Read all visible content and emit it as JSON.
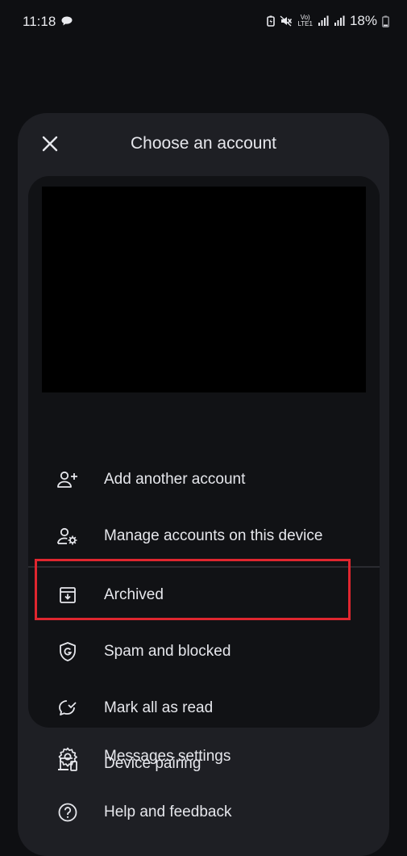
{
  "status_bar": {
    "time": "11:18",
    "volte_line1": "Vo)",
    "volte_line2": "LTE1",
    "battery": "18%"
  },
  "sheet": {
    "title": "Choose an account",
    "close_icon": "close-icon"
  },
  "menu": {
    "add_account": "Add another account",
    "manage_accounts": "Manage accounts on this device",
    "archived": "Archived",
    "spam": "Spam and blocked",
    "mark_read": "Mark all as read",
    "device_pairing": "Device pairing"
  },
  "outer_menu": {
    "settings": "Messages settings",
    "help": "Help and feedback"
  },
  "colors": {
    "background": "#0e0f12",
    "sheet": "#1e1f24",
    "card": "#111215",
    "highlight": "#e0262f",
    "text": "#e6e7ec"
  }
}
